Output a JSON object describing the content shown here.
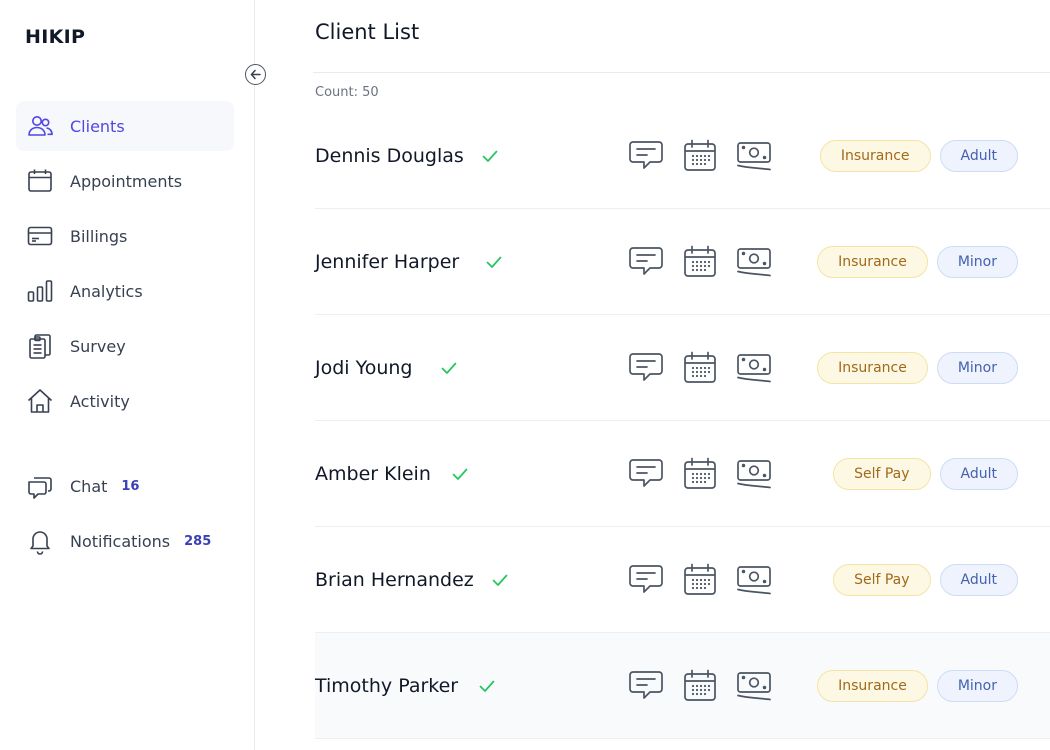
{
  "app": {
    "name": "HIKIP"
  },
  "sidebar": {
    "items": [
      {
        "label": "Clients",
        "icon": "users-icon"
      },
      {
        "label": "Appointments",
        "icon": "calendar-icon"
      },
      {
        "label": "Billings",
        "icon": "credit-card-icon"
      },
      {
        "label": "Analytics",
        "icon": "bar-chart-icon"
      },
      {
        "label": "Survey",
        "icon": "clipboard-icon"
      },
      {
        "label": "Activity",
        "icon": "home-icon"
      },
      {
        "label": "Chat",
        "icon": "chat-icon",
        "count": "16"
      },
      {
        "label": "Notifications",
        "icon": "bell-icon",
        "count": "285"
      }
    ],
    "active": "Clients",
    "accent_color": "#4f46e5"
  },
  "main": {
    "title": "Client List",
    "count_text": "Count: 50",
    "clients": [
      {
        "name": "Dennis Douglas",
        "payment": "Insurance",
        "age_group": "Adult"
      },
      {
        "name": "Jennifer Harper",
        "payment": "Insurance",
        "age_group": "Minor"
      },
      {
        "name": "Jodi Young",
        "payment": "Insurance",
        "age_group": "Minor"
      },
      {
        "name": "Amber Klein",
        "payment": "Self Pay",
        "age_group": "Adult"
      },
      {
        "name": "Brian Hernandez",
        "payment": "Self Pay",
        "age_group": "Adult"
      },
      {
        "name": "Timothy Parker",
        "payment": "Insurance",
        "age_group": "Minor"
      }
    ],
    "row_actions": [
      "message-icon",
      "calendar-icon",
      "money-icon"
    ]
  },
  "colors": {
    "verified_check": "#22c55e",
    "payment_badge_bg": "#fdf8e3",
    "payment_badge_text": "#a1691b",
    "age_badge_bg": "#eef3fd",
    "age_badge_text": "#4461b0"
  }
}
